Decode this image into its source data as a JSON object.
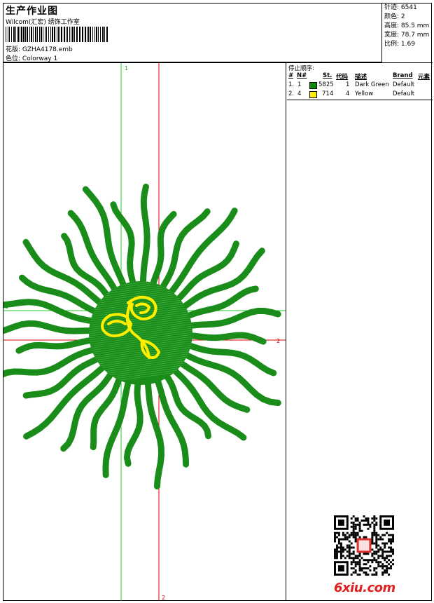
{
  "header": {
    "title": "生产作业图",
    "company": "Wilcom(汇宏) 绣饰工作室",
    "design_label": "花版:",
    "design_value": "GZHA4178.emb",
    "colorway_label": "色位:",
    "colorway_value": "Colorway 1"
  },
  "stats": {
    "stitches": "针迹: 6541",
    "colors": "颜色: 2",
    "height": "高度: 85.5 mm",
    "width": "宽度: 78.7 mm",
    "scale": "比例: 1.69"
  },
  "canvas": {
    "guide1_label": "1",
    "guide2_label": "2",
    "colors": {
      "green": "#1a8c1a",
      "yellow": "#ffee00",
      "guide_green": "#22cc22",
      "guide_red": "#dd0000"
    }
  },
  "stop_table": {
    "caption": "停止顺序:",
    "headers": [
      "#",
      "N#",
      "St.",
      "代码",
      "描述",
      "Brand",
      "元素"
    ],
    "rows": [
      {
        "idx": "1.",
        "n": "1",
        "stitches": "5825",
        "code": "1",
        "desc": "Dark Green",
        "brand": "Default",
        "color": "#0a8a0a"
      },
      {
        "idx": "2.",
        "n": "4",
        "stitches": "714",
        "code": "4",
        "desc": "Yellow",
        "brand": "Default",
        "color": "#ffee00"
      }
    ]
  },
  "watermark": {
    "brand": "6xiu.com"
  }
}
